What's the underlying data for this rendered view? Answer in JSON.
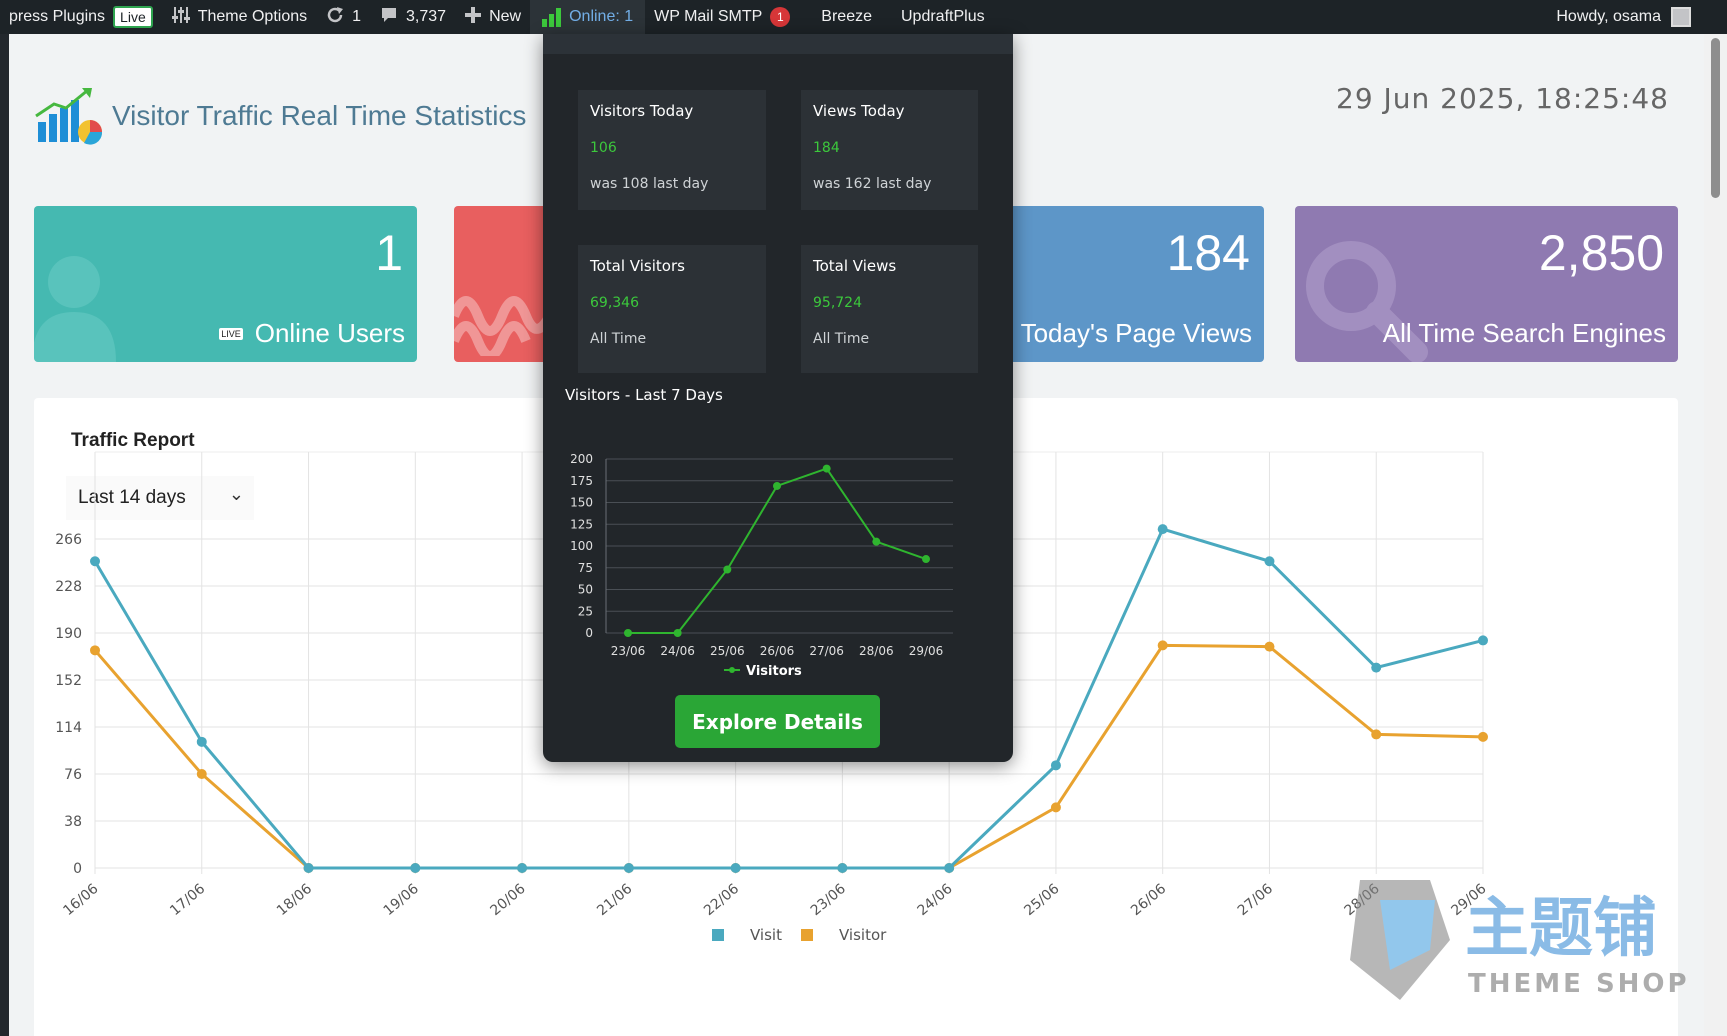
{
  "adminbar": {
    "plugins_label": "press Plugins",
    "live_badge": "Live",
    "theme_options": "Theme Options",
    "updates_count": "1",
    "comments_count": "3,737",
    "new_label": "New",
    "online_label": "Online: 1",
    "wp_mail_smtp": "WP Mail SMTP",
    "wp_mail_badge": "1",
    "breeze": "Breeze",
    "updraft": "UpdraftPlus",
    "howdy": "Howdy, osama"
  },
  "header": {
    "title": "Visitor Traffic Real Time Statistics",
    "datetime": "29 Jun 2025, 18:25:48"
  },
  "cards": {
    "online_value": "1",
    "online_label": "Online Users",
    "live_icon_text": "LIVE",
    "page_views_value": "184",
    "page_views_label": "Today's Page Views",
    "search_value": "2,850",
    "search_label": "All Time Search Engines"
  },
  "traffic": {
    "title": "Traffic Report",
    "range": "Last 14 days"
  },
  "popup": {
    "visitors_today_title": "Visitors Today",
    "visitors_today_value": "106",
    "visitors_today_sub": "was 108 last day",
    "views_today_title": "Views Today",
    "views_today_value": "184",
    "views_today_sub": "was 162 last day",
    "total_visitors_title": "Total Visitors",
    "total_visitors_value": "69,346",
    "total_visitors_sub": "All Time",
    "total_views_title": "Total Views",
    "total_views_value": "95,724",
    "total_views_sub": "All Time",
    "chart_title": "Visitors - Last 7 Days",
    "explore_label": "Explore Details"
  },
  "watermark": {
    "cn": "主题铺",
    "en": "THEME SHOP"
  },
  "colors": {
    "visit": "#4aa9bf",
    "visitor": "#e8a22f",
    "mini_line": "#2fb52f"
  },
  "chart_data": [
    {
      "type": "line",
      "id": "traffic",
      "categories": [
        "16/06",
        "17/06",
        "18/06",
        "19/06",
        "20/06",
        "21/06",
        "22/06",
        "23/06",
        "24/06",
        "25/06",
        "26/06",
        "27/06",
        "28/06",
        "29/06"
      ],
      "series": [
        {
          "name": "Visit",
          "values": [
            248,
            102,
            0,
            0,
            0,
            0,
            0,
            0,
            0,
            83,
            274,
            248,
            162,
            184
          ]
        },
        {
          "name": "Visitor",
          "values": [
            176,
            76,
            0,
            0,
            0,
            0,
            0,
            0,
            0,
            49,
            180,
            179,
            108,
            106
          ]
        }
      ],
      "yticks": [
        0,
        38,
        76,
        114,
        152,
        190,
        228,
        266
      ],
      "ylim": [
        0,
        304
      ],
      "legend": "bottom"
    },
    {
      "type": "line",
      "id": "visitors7",
      "categories": [
        "23/06",
        "24/06",
        "25/06",
        "26/06",
        "27/06",
        "28/06",
        "29/06"
      ],
      "series": [
        {
          "name": "Visitors",
          "values": [
            0,
            0,
            73,
            169,
            189,
            105,
            85
          ]
        }
      ],
      "yticks": [
        0,
        25,
        50,
        75,
        100,
        125,
        150,
        175,
        200
      ],
      "ylim": [
        0,
        200
      ],
      "legend": "bottom"
    }
  ]
}
